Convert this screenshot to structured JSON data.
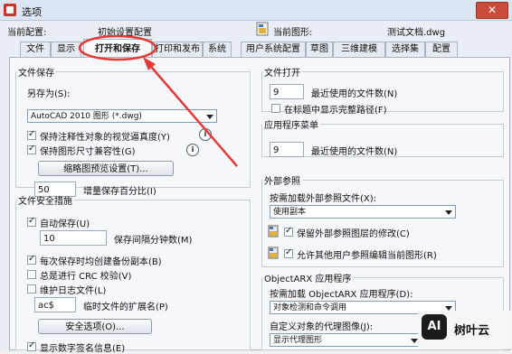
{
  "window": {
    "title": "选项",
    "close_label": "✕"
  },
  "header": {
    "current_config_label": "当前配置:",
    "current_config_value": "初始设置配置",
    "current_drawing_label": "当前图形:",
    "current_drawing_value": "测试文档.dwg"
  },
  "tabs": [
    "文件",
    "显示",
    "打开和保存",
    "打印和发布",
    "系统",
    "用户系统配置",
    "草图",
    "三维建模",
    "选择集",
    "配置"
  ],
  "active_tab": "打开和保存",
  "file_save": {
    "legend": "文件保存",
    "save_as_label": "另存为(S):",
    "save_as_value": "AutoCAD 2010 图形 (*.dwg)",
    "check_annot": "保持注释性对象的视觉逼真度(Y)",
    "check_size": "保持图形尺寸兼容性(G)",
    "thumb_button": "缩略图预览设置(T)...",
    "incr_value": "50",
    "incr_label": "增量保存百分比(I)"
  },
  "file_safety": {
    "legend": "文件安全措施",
    "autosave_label": "自动保存(U)",
    "interval_value": "10",
    "interval_label": "保存间隔分钟数(M)",
    "backup_label": "每次保存时均创建备份副本(B)",
    "crc_label": "总是进行 CRC 校验(V)",
    "log_label": "维护日志文件(L)",
    "ext_value": "ac$",
    "ext_label": "临时文件的扩展名(P)",
    "security_button": "安全选项(O)...",
    "digital_sig_label": "显示数字签名信息(E)"
  },
  "file_open": {
    "legend": "文件打开",
    "recent_value": "9",
    "recent_label": "最近使用的文件数(N)",
    "fullpath_label": "在标题中显示完整路径(F)"
  },
  "app_menu": {
    "legend": "应用程序菜单",
    "recent_value": "9",
    "recent_label": "最近使用的文件数(N)"
  },
  "xref": {
    "legend": "外部参照",
    "demand_label": "按需加载外部参照文件(X):",
    "demand_value": "使用副本",
    "retain_label": "保留外部参照图层的修改(C)",
    "allow_label": "允许其他用户参照编辑当前图形(R)"
  },
  "objectarx": {
    "legend": "ObjectARX 应用程序",
    "demand_label": "按需加载 ObjectARX 应用程序(D):",
    "demand_value": "对象检测和命令调用",
    "proxy_label": "自定义对象的代理图像(J):",
    "proxy_value": "显示代理图形"
  },
  "watermark": {
    "logo": "AI",
    "text": "树叶云"
  },
  "colors": {
    "annotation_arrow": "#e03a3a",
    "accent": "#3c6ea8"
  }
}
